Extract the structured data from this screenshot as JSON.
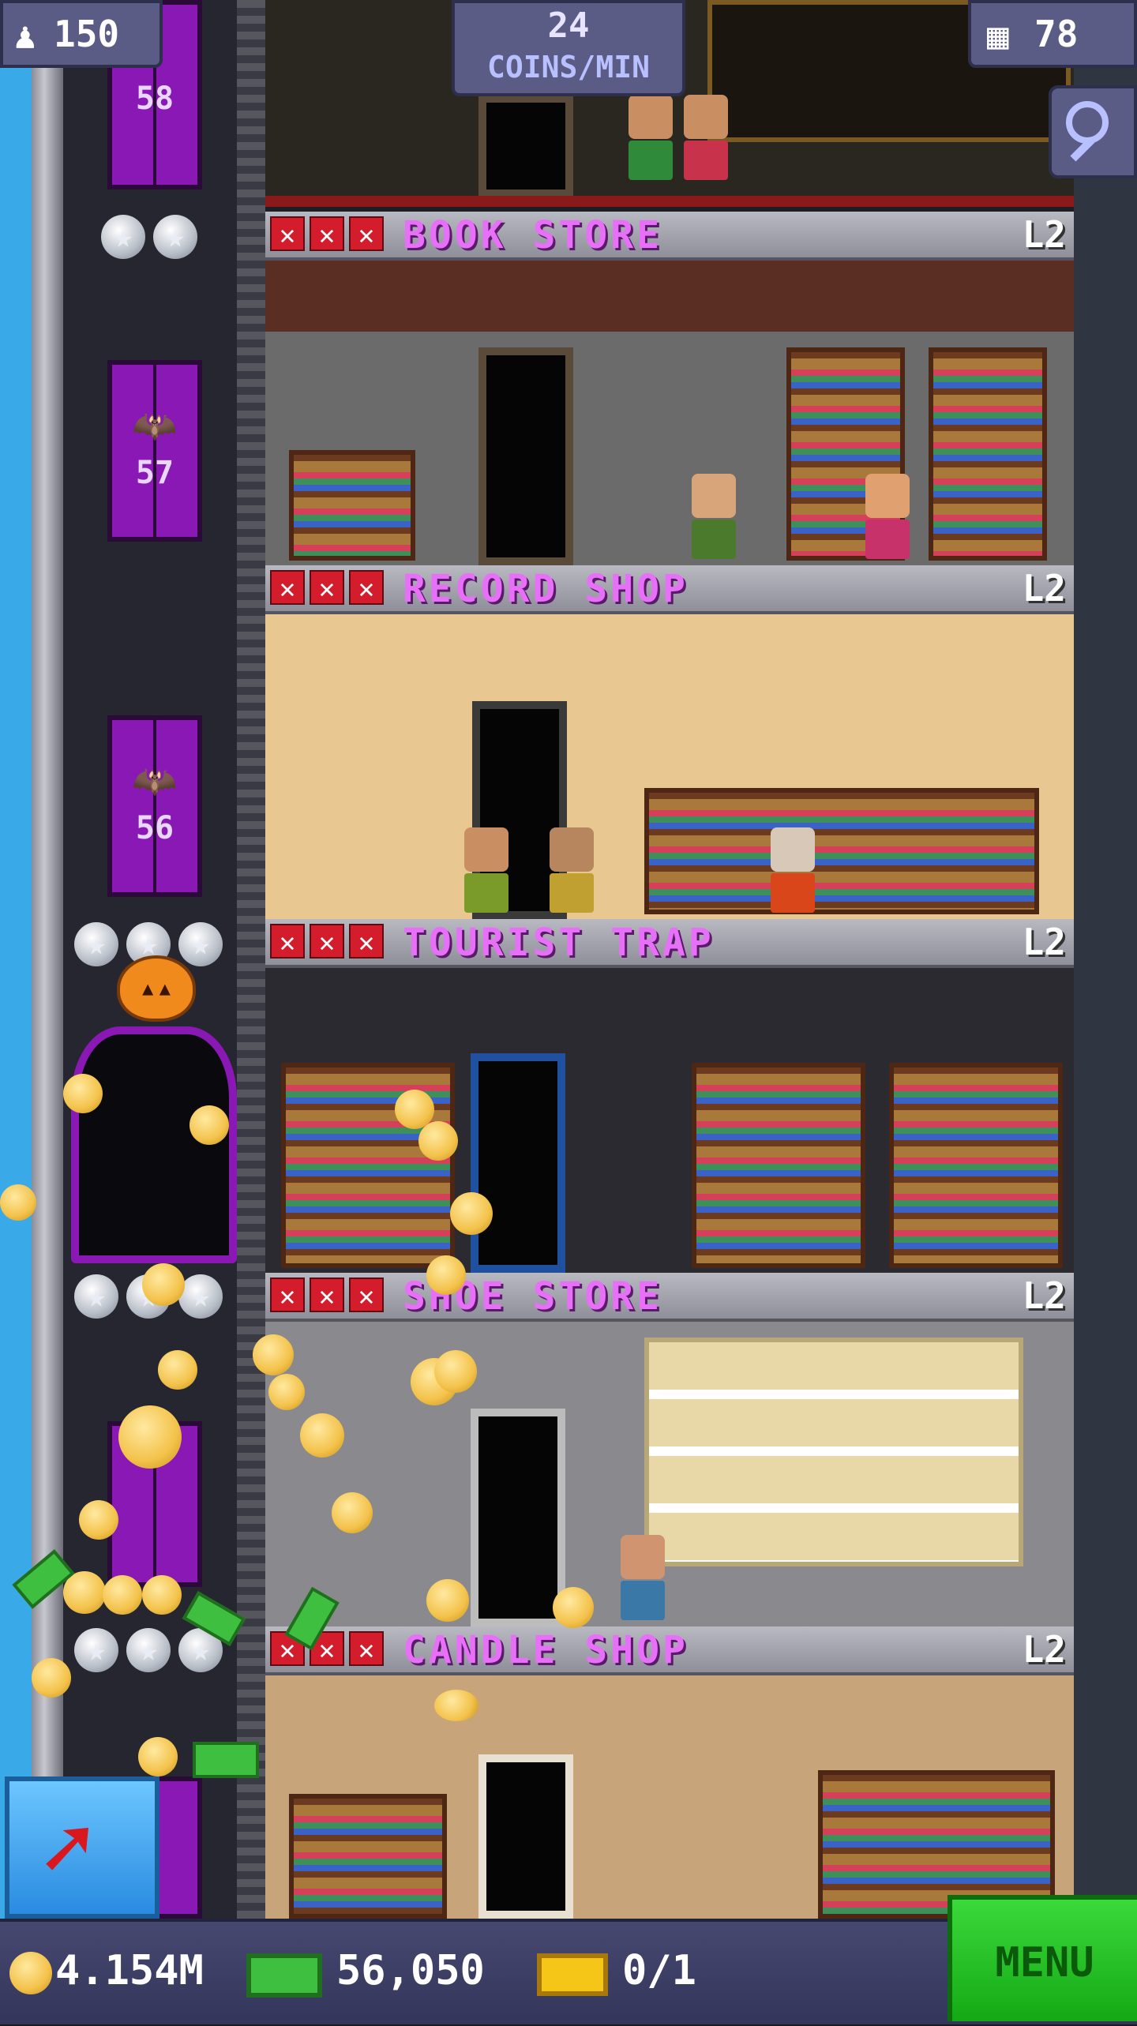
{
  "hud": {
    "population": "150",
    "rate_value": "24",
    "rate_unit": "COINS/MIN",
    "floors": "78"
  },
  "elevator": {
    "floor_numbers": [
      "58",
      "57",
      "56"
    ]
  },
  "floors": [
    {
      "name": "BOOK STORE",
      "level": "L2"
    },
    {
      "name": "RECORD SHOP",
      "level": "L2"
    },
    {
      "name": "TOURIST TRAP",
      "level": "L2"
    },
    {
      "name": "SHOE STORE",
      "level": "L2"
    },
    {
      "name": "CANDLE SHOP",
      "level": "L2"
    }
  ],
  "bottom_bar": {
    "coins": "4.154M",
    "bux": "56,050",
    "tickets": "0/1",
    "menu_label": "MENU"
  },
  "icons": {
    "population": "person-icon",
    "floors": "building-icon",
    "search": "magnifier-icon",
    "share": "arrow-up-right-icon",
    "coin": "coin-icon",
    "bux": "bux-icon",
    "ticket": "ticket-icon",
    "stock_missing": "red-x-icon",
    "star": "star-icon",
    "bat": "bat-icon",
    "pumpkin": "pumpkin-icon"
  },
  "colors": {
    "floor_name": "#e86ff7",
    "elevator": "#8a18b5",
    "menu_green": "#22c022",
    "sky": "#3aa9e8",
    "hud_panel": "#5a5c86"
  }
}
